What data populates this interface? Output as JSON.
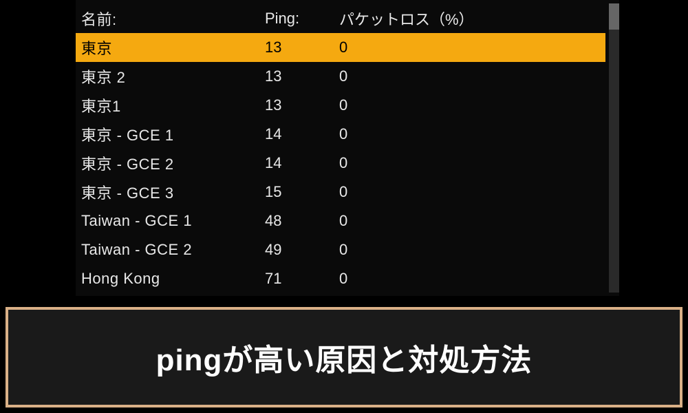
{
  "table": {
    "headers": {
      "name": "名前:",
      "ping": "Ping:",
      "loss": "パケットロス（%）"
    },
    "rows": [
      {
        "name": "東京",
        "ping": "13",
        "loss": "0",
        "selected": true
      },
      {
        "name": "東京 2",
        "ping": "13",
        "loss": "0",
        "selected": false
      },
      {
        "name": "東京1",
        "ping": "13",
        "loss": "0",
        "selected": false
      },
      {
        "name": "東京 - GCE 1",
        "ping": "14",
        "loss": "0",
        "selected": false
      },
      {
        "name": "東京 - GCE 2",
        "ping": "14",
        "loss": "0",
        "selected": false
      },
      {
        "name": "東京 - GCE 3",
        "ping": "15",
        "loss": "0",
        "selected": false
      },
      {
        "name": "Taiwan - GCE 1",
        "ping": "48",
        "loss": "0",
        "selected": false
      },
      {
        "name": "Taiwan - GCE 2",
        "ping": "49",
        "loss": "0",
        "selected": false
      },
      {
        "name": "Hong Kong",
        "ping": "71",
        "loss": "0",
        "selected": false
      }
    ]
  },
  "banner": {
    "text": "pingが高い原因と対処方法"
  },
  "colors": {
    "highlight": "#f5a910",
    "banner_border": "#d9b087"
  }
}
